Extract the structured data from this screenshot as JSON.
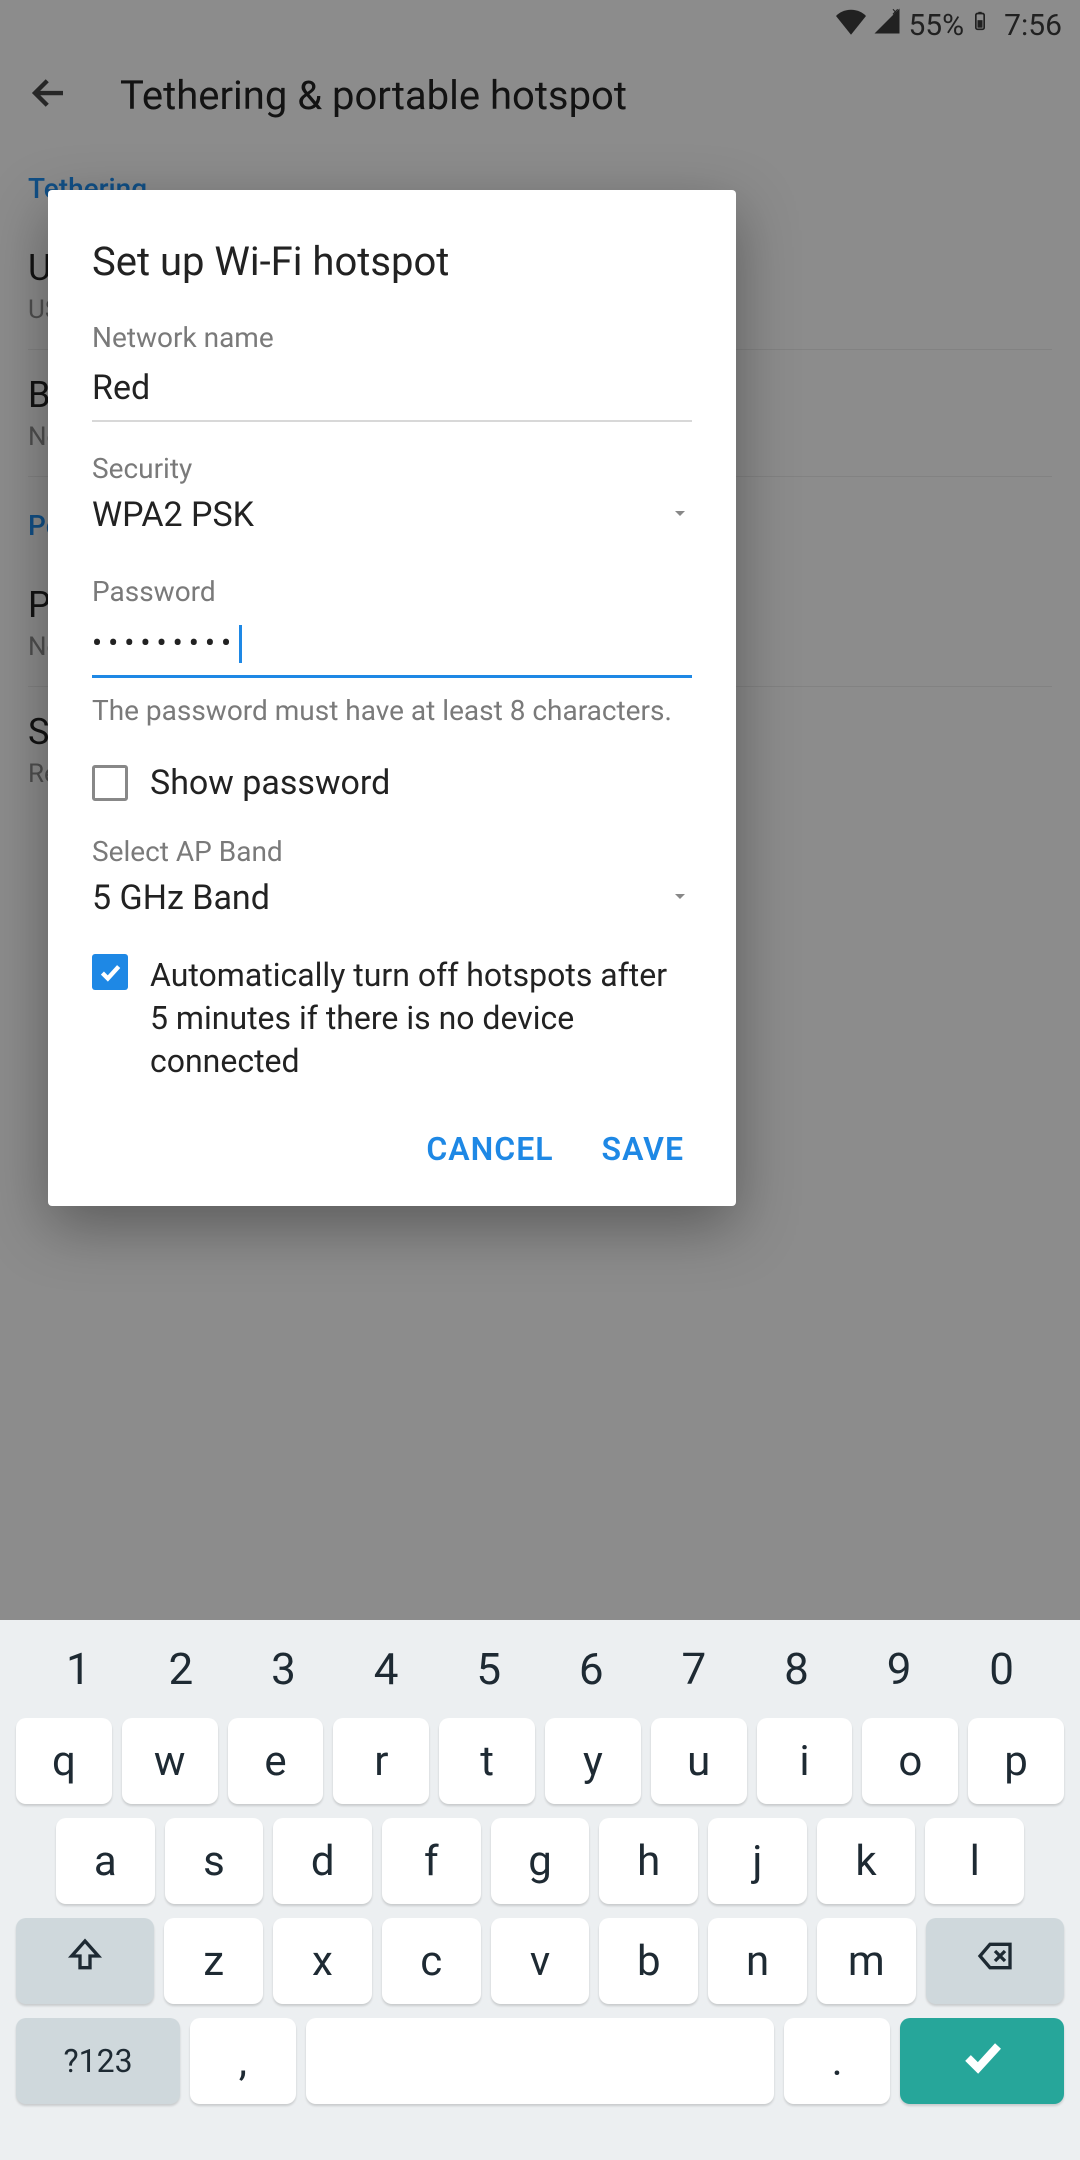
{
  "status": {
    "battery": "55%",
    "time": "7:56"
  },
  "appbar": {
    "title": "Tethering & portable hotspot"
  },
  "bg": {
    "section1": "Tethering",
    "section2": "Po",
    "items": [
      {
        "t": "U",
        "s": "US"
      },
      {
        "t": "Bl",
        "s": "No"
      },
      {
        "t": "Po",
        "s": "No"
      },
      {
        "t": "Se",
        "s": "Re"
      }
    ]
  },
  "dialog": {
    "title": "Set up Wi-Fi hotspot",
    "network_label": "Network name",
    "network_value": "Red",
    "security_label": "Security",
    "security_value": "WPA2 PSK",
    "password_label": "Password",
    "password_value": "•••••••••",
    "password_hint": "The password must have at least 8 characters.",
    "show_password": "Show password",
    "ap_label": "Select AP Band",
    "ap_value": "5 GHz Band",
    "auto_off": "Automatically turn off hotspots after 5 minutes if there is no device connected",
    "cancel": "CANCEL",
    "save": "SAVE"
  },
  "kb": {
    "nums": [
      "1",
      "2",
      "3",
      "4",
      "5",
      "6",
      "7",
      "8",
      "9",
      "0"
    ],
    "r2": [
      "q",
      "w",
      "e",
      "r",
      "t",
      "y",
      "u",
      "i",
      "o",
      "p"
    ],
    "r3": [
      "a",
      "s",
      "d",
      "f",
      "g",
      "h",
      "j",
      "k",
      "l"
    ],
    "r4": [
      "z",
      "x",
      "c",
      "v",
      "b",
      "n",
      "m"
    ],
    "sym": "?123",
    "comma": ",",
    "period": "."
  }
}
